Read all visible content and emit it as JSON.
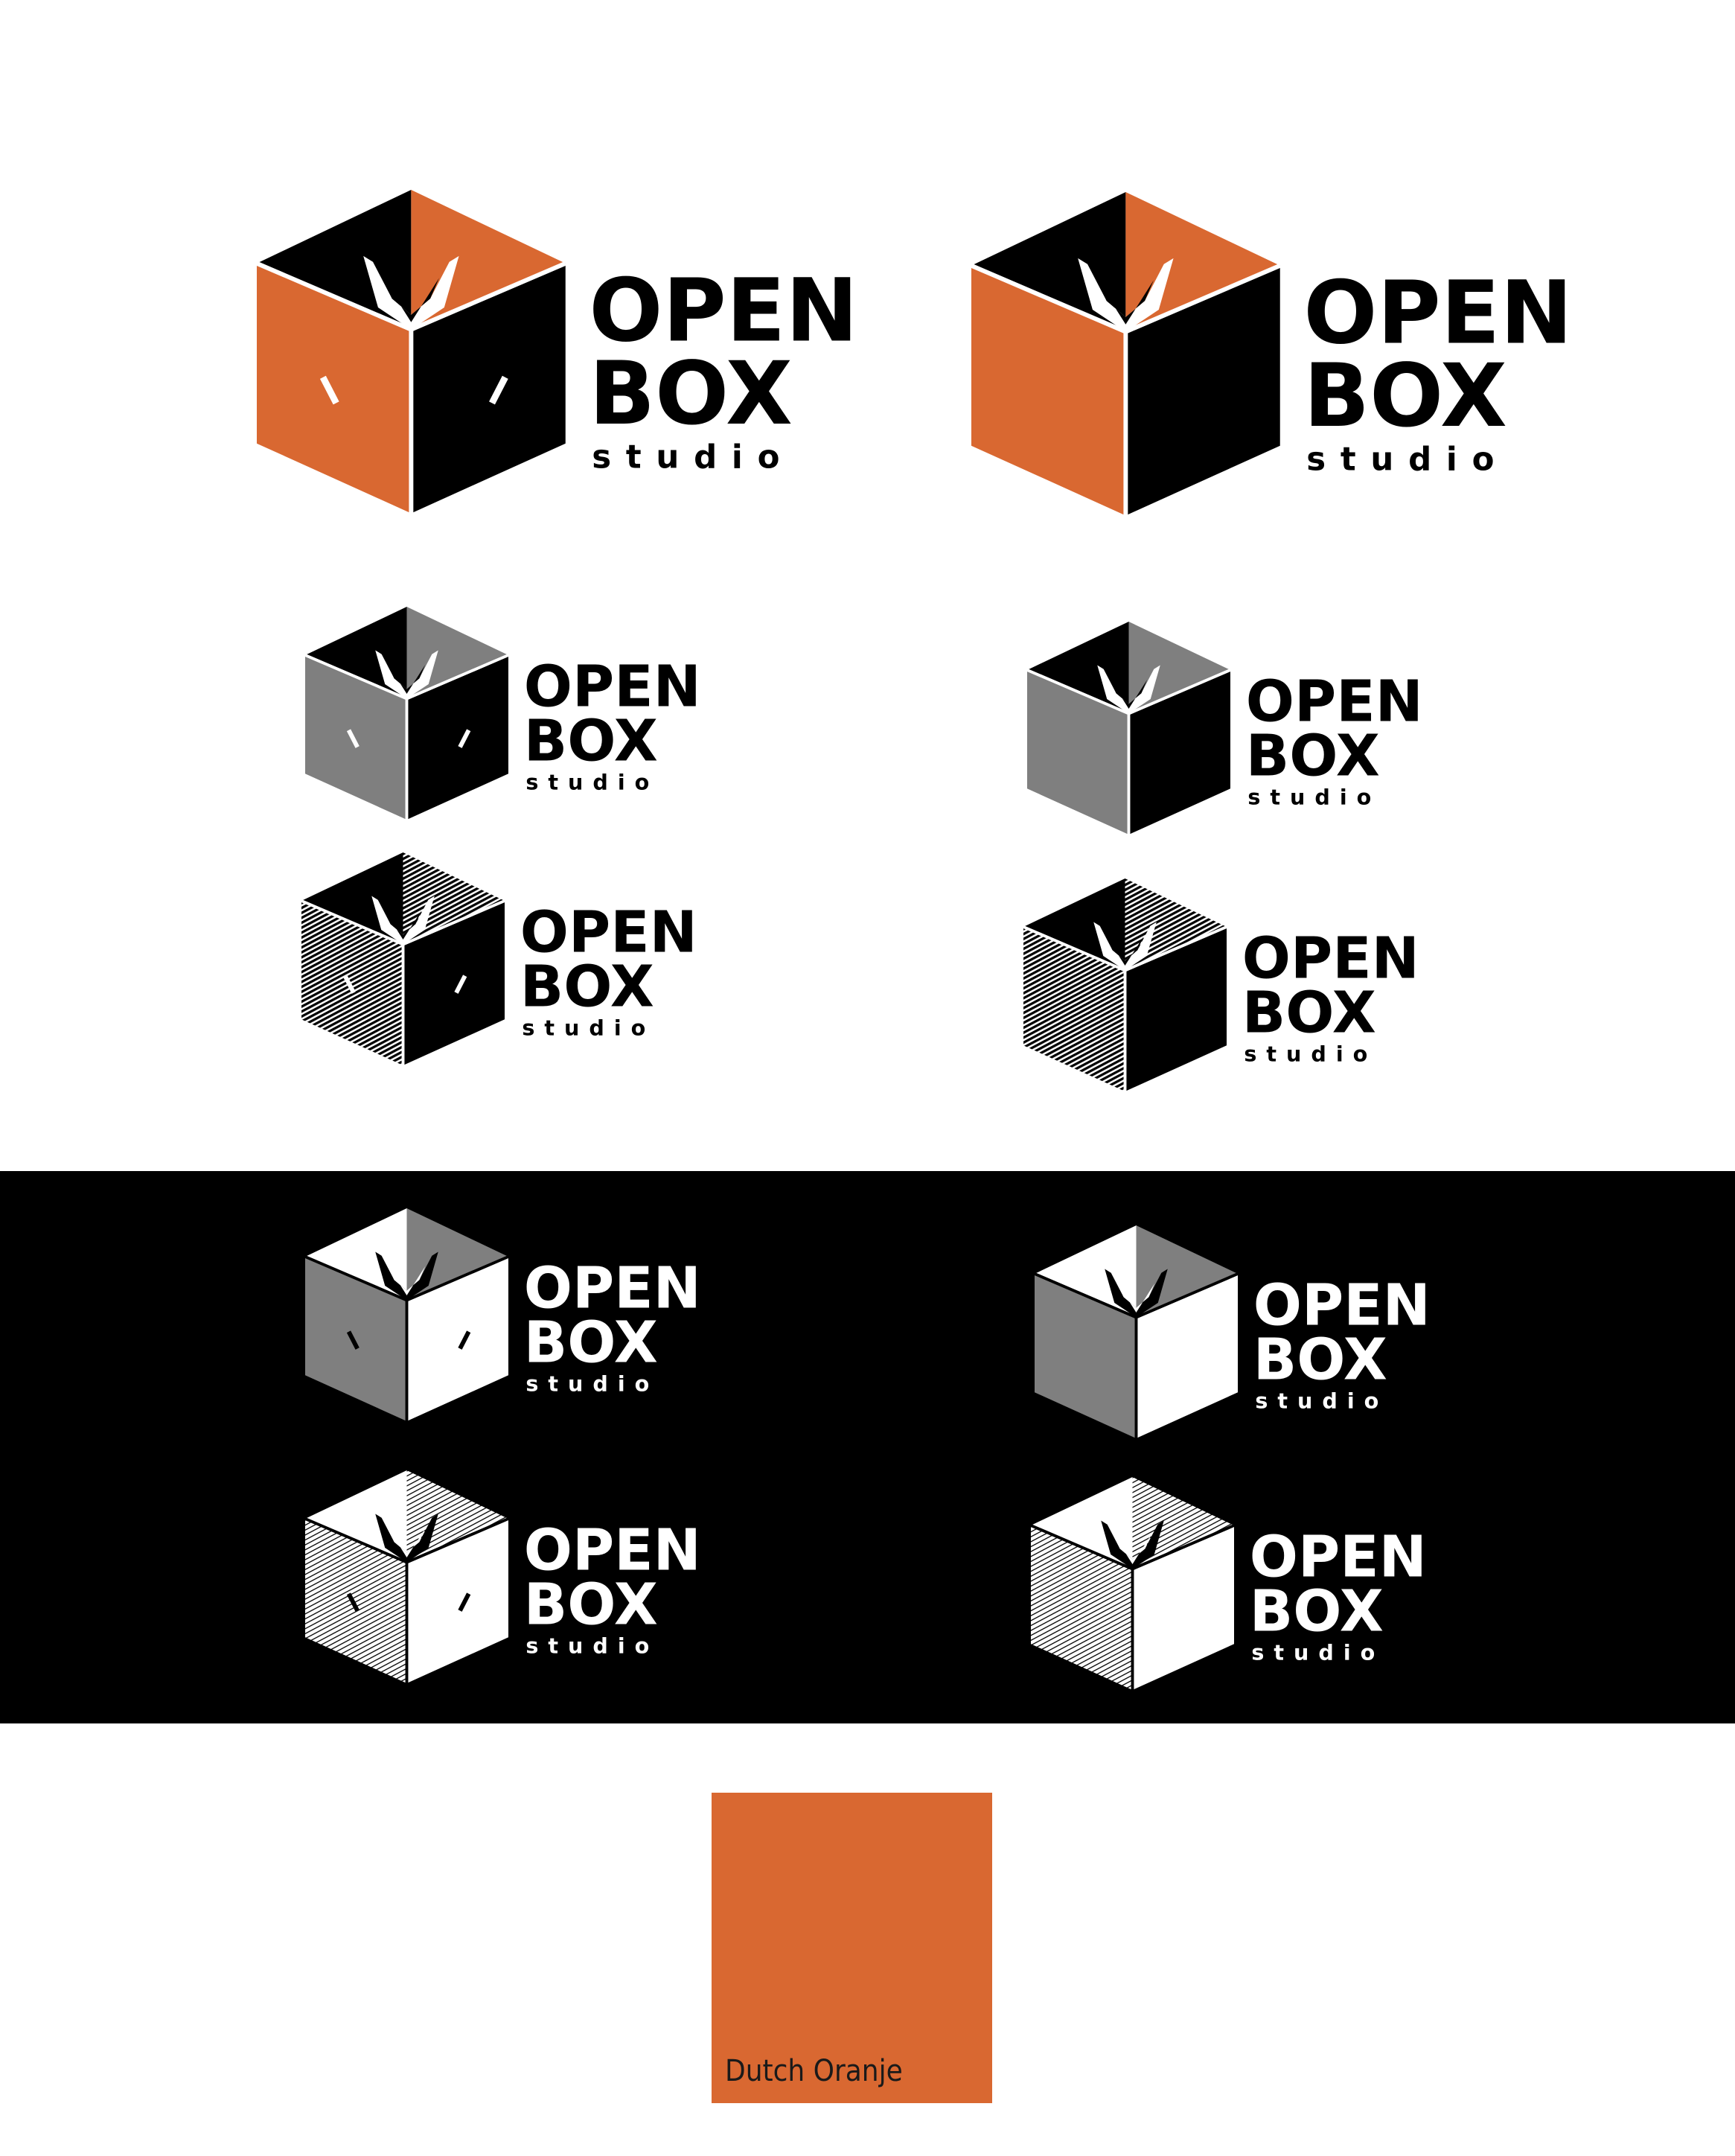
{
  "brand": {
    "line1": "OPEN",
    "line2": "BOX",
    "line3": "studio"
  },
  "colors": {
    "orange": "#d96831",
    "gray": "#7f7f7f",
    "black": "#000000",
    "white": "#ffffff"
  },
  "variants": [
    {
      "name": "orange-eyes"
    },
    {
      "name": "orange-plain"
    },
    {
      "name": "gray-eyes"
    },
    {
      "name": "gray-plain"
    },
    {
      "name": "hatch-eyes"
    },
    {
      "name": "hatch-plain"
    },
    {
      "name": "inverse-gray-eyes"
    },
    {
      "name": "inverse-gray-plain"
    },
    {
      "name": "inverse-hatch-eyes"
    },
    {
      "name": "inverse-hatch-plain"
    }
  ],
  "swatch": {
    "label": "Dutch Oranje",
    "color": "#d96831"
  }
}
